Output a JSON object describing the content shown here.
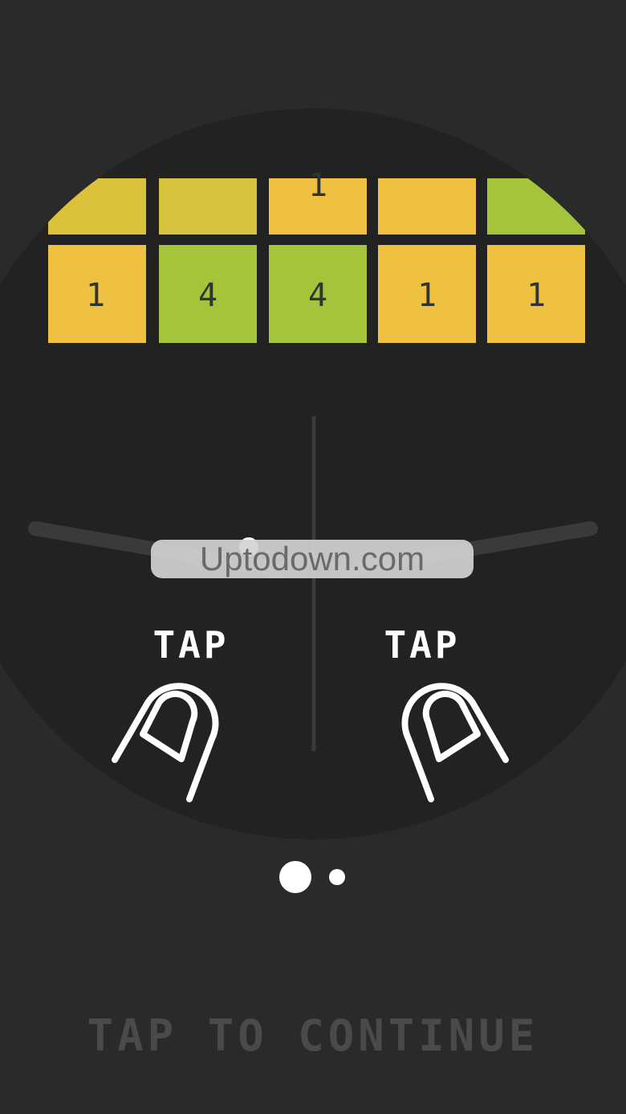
{
  "board": {
    "rows": [
      {
        "row": "top",
        "bricks": [
          {
            "value": "",
            "color": "#dcc23a"
          },
          {
            "value": "",
            "color": "#d6c23c"
          },
          {
            "value": "1",
            "color": "#efc141"
          },
          {
            "value": "",
            "color": "#efc141"
          },
          {
            "value": "",
            "color": "#a4c53b"
          }
        ]
      },
      {
        "row": "bottom",
        "bricks": [
          {
            "value": "1",
            "color": "#efc141"
          },
          {
            "value": "4",
            "color": "#a4c53b"
          },
          {
            "value": "4",
            "color": "#a4c53b"
          },
          {
            "value": "1",
            "color": "#efc141"
          },
          {
            "value": "1",
            "color": "#efc141"
          }
        ]
      }
    ]
  },
  "controls": {
    "left_label": "TAP",
    "right_label": "TAP"
  },
  "watermark": "Uptodown.com",
  "pager": {
    "pages": 2,
    "current": 1
  },
  "footer": {
    "prompt": "TAP TO CONTINUE"
  },
  "colors": {
    "background": "#2a2a2a",
    "arena": "#222222",
    "yellow": "#efc141",
    "green": "#a4c53b",
    "flipper": "#3a3a3a",
    "text": "#ffffff",
    "footer_text": "#4a4a4a"
  }
}
